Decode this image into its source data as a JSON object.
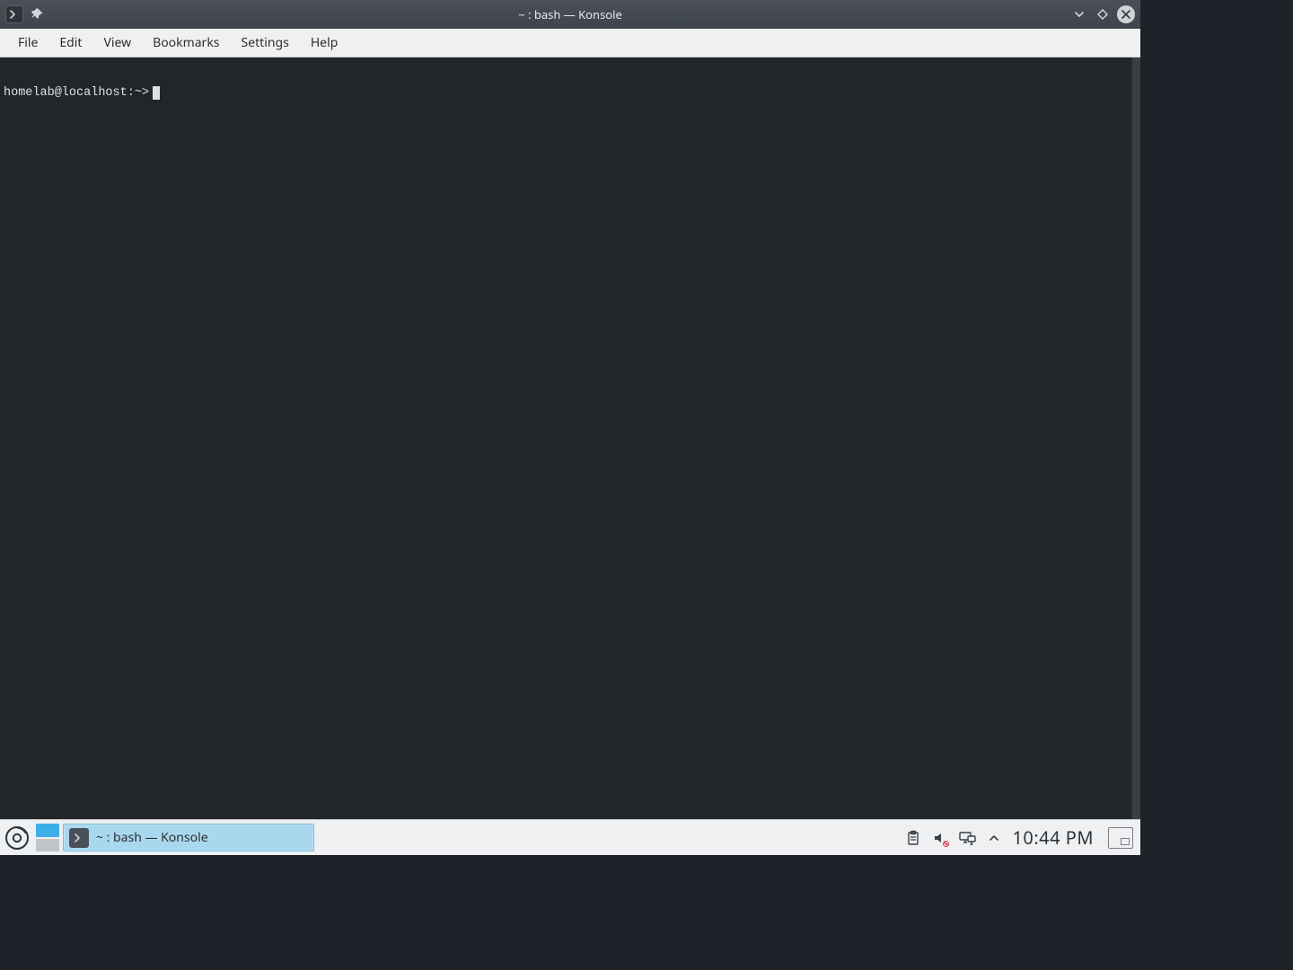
{
  "window": {
    "title": "~ : bash — Konsole"
  },
  "menubar": {
    "items": [
      "File",
      "Edit",
      "View",
      "Bookmarks",
      "Settings",
      "Help"
    ]
  },
  "terminal": {
    "prompt": "homelab@localhost:~>"
  },
  "taskbar": {
    "entry_label": "~ : bash — Konsole",
    "clock": "10:44 PM"
  }
}
